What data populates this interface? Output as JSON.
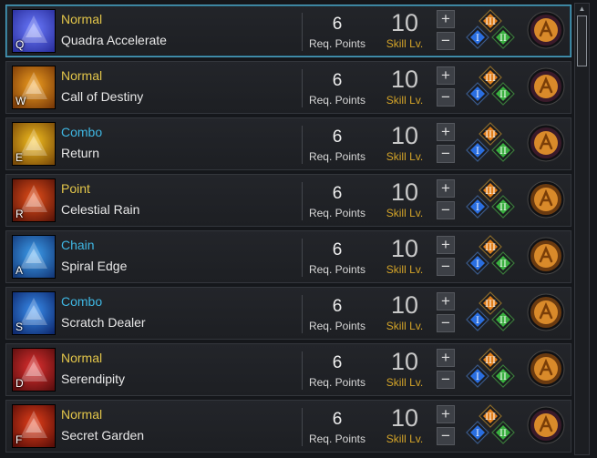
{
  "labels": {
    "req_points": "Req. Points",
    "skill_lv": "Skill Lv.",
    "plus": "+",
    "minus": "−"
  },
  "tripod_numerals": [
    "I",
    "II",
    "III"
  ],
  "skills": [
    {
      "hotkey": "Q",
      "type": "Normal",
      "name": "Quadra Accelerate",
      "req_points": "6",
      "skill_lv": "10",
      "icon": "quadra-accelerate-icon",
      "colors": [
        "#2a2f9e",
        "#6c7cff"
      ],
      "rune": "#3a1a2a"
    },
    {
      "hotkey": "W",
      "type": "Normal",
      "name": "Call of Destiny",
      "req_points": "6",
      "skill_lv": "10",
      "icon": "call-of-destiny-icon",
      "colors": [
        "#7a3a08",
        "#f2a020"
      ],
      "rune": "#3a1a2a"
    },
    {
      "hotkey": "E",
      "type": "Combo",
      "name": "Return",
      "req_points": "6",
      "skill_lv": "10",
      "icon": "return-icon",
      "colors": [
        "#7a4a08",
        "#f5c020"
      ],
      "rune": "#3a1a2a"
    },
    {
      "hotkey": "R",
      "type": "Point",
      "name": "Celestial Rain",
      "req_points": "6",
      "skill_lv": "10",
      "icon": "celestial-rain-icon",
      "colors": [
        "#5a1408",
        "#e8501a"
      ],
      "rune": "#6a3a10"
    },
    {
      "hotkey": "A",
      "type": "Chain",
      "name": "Spiral Edge",
      "req_points": "6",
      "skill_lv": "10",
      "icon": "spiral-edge-icon",
      "colors": [
        "#143a7a",
        "#3ea0f0"
      ],
      "rune": "#6a3a10"
    },
    {
      "hotkey": "S",
      "type": "Combo",
      "name": "Scratch Dealer",
      "req_points": "6",
      "skill_lv": "10",
      "icon": "scratch-dealer-icon",
      "colors": [
        "#0e2a70",
        "#3a90f0"
      ],
      "rune": "#6a3a10"
    },
    {
      "hotkey": "D",
      "type": "Normal",
      "name": "Serendipity",
      "req_points": "6",
      "skill_lv": "10",
      "icon": "serendipity-icon",
      "colors": [
        "#5a0e0e",
        "#e23030"
      ],
      "rune": "#6a3a10"
    },
    {
      "hotkey": "F",
      "type": "Normal",
      "name": "Secret Garden",
      "req_points": "6",
      "skill_lv": "10",
      "icon": "secret-garden-icon",
      "colors": [
        "#5a0e08",
        "#e8401a"
      ],
      "rune": "#3a1a2a"
    }
  ],
  "type_colors": {
    "Normal": "#e3c64a",
    "Combo": "#3fb7e3",
    "Point": "#e3c64a",
    "Chain": "#3fb7e3"
  },
  "scrollbar": {
    "up_arrow": "▲"
  }
}
